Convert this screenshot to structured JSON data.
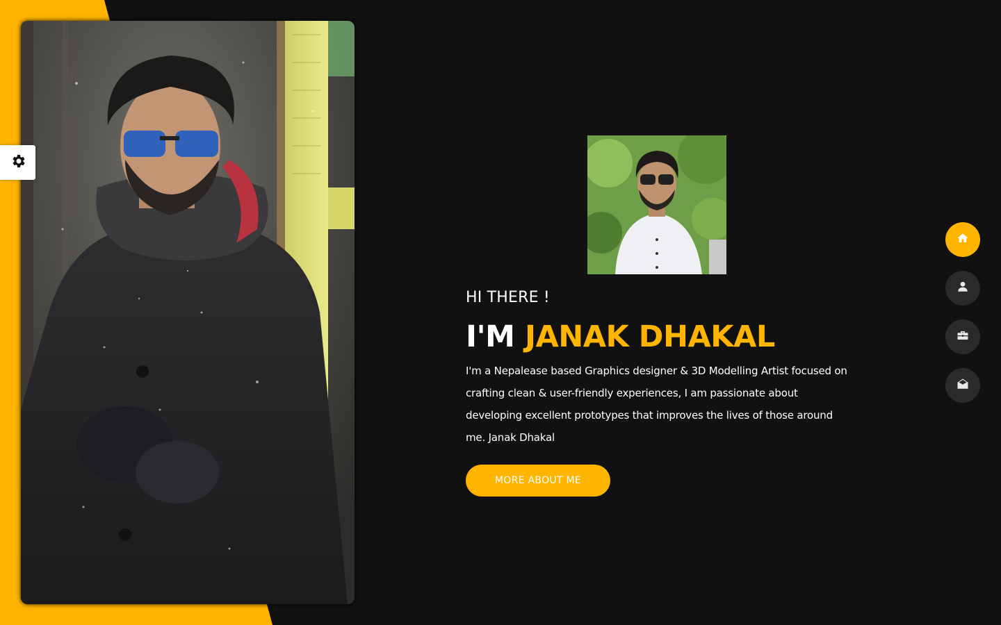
{
  "theme": {
    "accent": "#ffb400",
    "background": "#111111",
    "nav_button_bg": "#2b2a2a",
    "text": "#ffffff"
  },
  "hero": {
    "greeting": "HI THERE !",
    "headline_prefix": "I'M",
    "name": "JANAK DHAKAL",
    "bio": "I'm a Nepalease based Graphics designer & 3D Modelling Artist focused on crafting clean & user-friendly experiences, I am passionate about developing excellent prototypes that improves the lives of those around me. Janak Dhakal",
    "cta_label": "MORE ABOUT ME"
  },
  "settings": {
    "icon": "gear-icon"
  },
  "nav": {
    "items": [
      {
        "id": "home",
        "icon": "home-icon",
        "active": true
      },
      {
        "id": "about",
        "icon": "user-icon",
        "active": false
      },
      {
        "id": "portfolio",
        "icon": "briefcase-icon",
        "active": false
      },
      {
        "id": "contact",
        "icon": "envelope-open-icon",
        "active": false
      }
    ]
  }
}
